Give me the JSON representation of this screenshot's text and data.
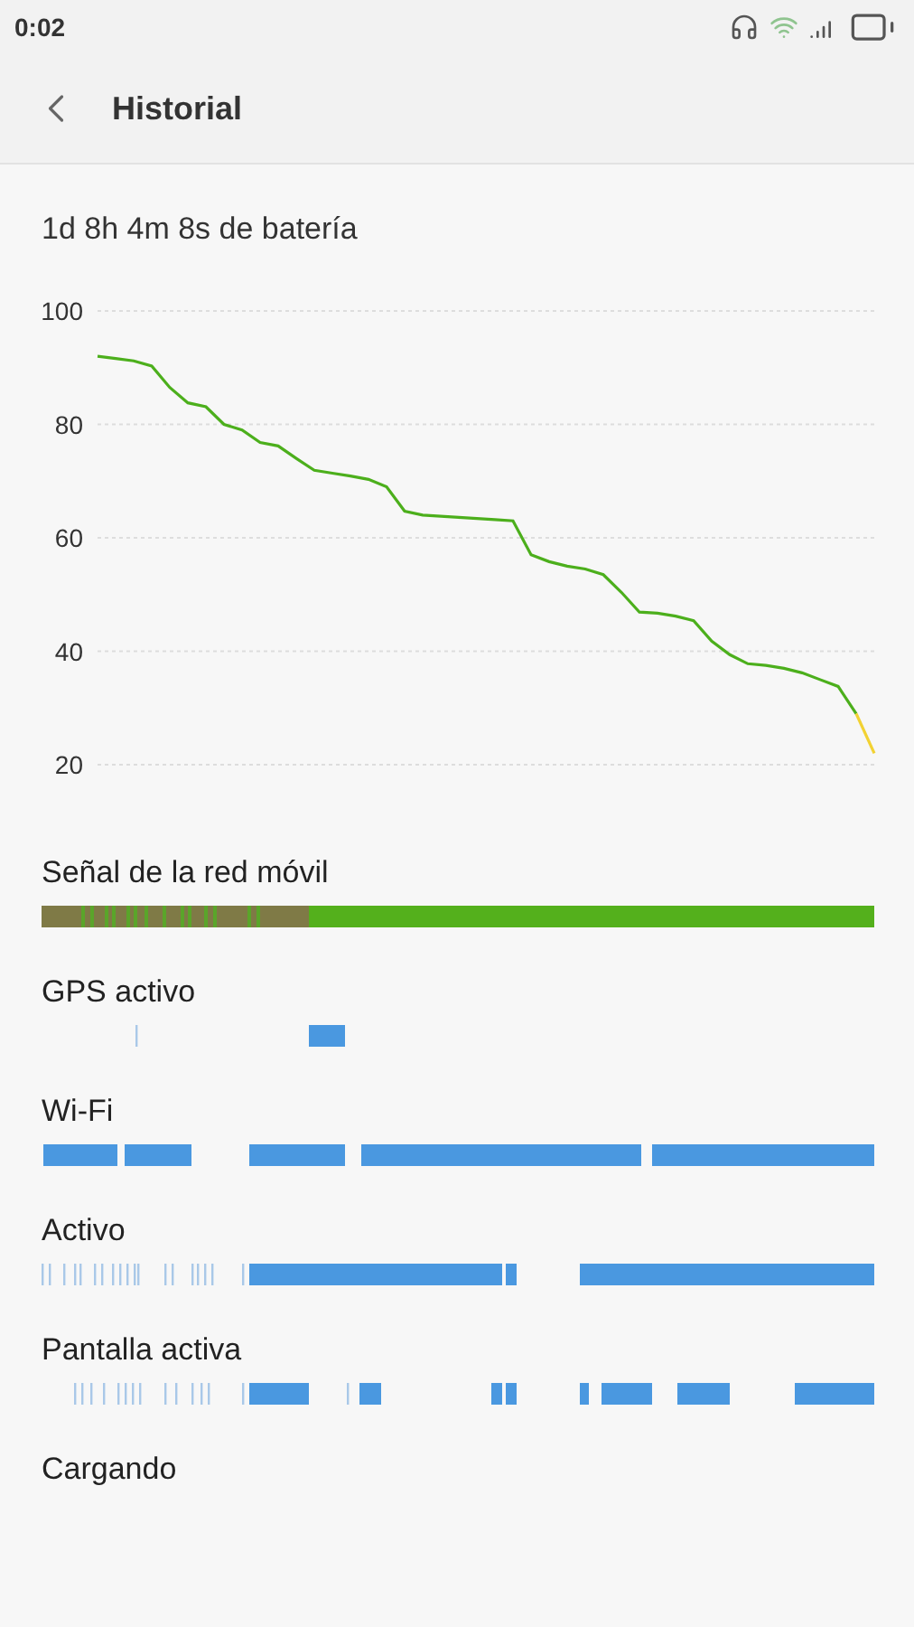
{
  "status_bar": {
    "time": "0:02"
  },
  "header": {
    "title": "Historial"
  },
  "battery_summary": "1d 8h 4m 8s de batería",
  "chart_data": {
    "type": "line",
    "grid": true,
    "ylim": [
      20,
      100
    ],
    "yticks": [
      20,
      40,
      60,
      80,
      100
    ],
    "categories": [
      null,
      null,
      null,
      null,
      null,
      null,
      null,
      null,
      null,
      null,
      null,
      null,
      null,
      null,
      null,
      null,
      null,
      null,
      null,
      null,
      null,
      null,
      null,
      null,
      null,
      null,
      null,
      null,
      null,
      null,
      null,
      null,
      null,
      null,
      null,
      null,
      null,
      null,
      null,
      null,
      null,
      null,
      null,
      null
    ],
    "series": [
      {
        "color": "#4caf1c",
        "values": [
          92,
          91.6,
          91.2,
          90.3,
          86.5,
          83.8,
          83.1,
          80,
          79,
          76.8,
          76.2,
          74,
          71.9,
          71.4,
          70.9,
          70.3,
          69,
          64.7,
          64,
          63.8,
          63.6,
          63.4,
          63.2,
          63,
          57,
          55.8,
          55,
          54.5,
          53.5,
          50.4,
          46.9,
          46.7,
          46.2,
          45.4,
          41.8,
          39.4,
          37.8,
          37.5,
          37,
          36.2,
          35,
          33.8,
          29,
          null
        ]
      },
      {
        "color": "#f2d233",
        "values": [
          null,
          null,
          null,
          null,
          null,
          null,
          null,
          null,
          null,
          null,
          null,
          null,
          null,
          null,
          null,
          null,
          null,
          null,
          null,
          null,
          null,
          null,
          null,
          null,
          null,
          null,
          null,
          null,
          null,
          null,
          null,
          null,
          null,
          null,
          null,
          null,
          null,
          null,
          null,
          null,
          null,
          null,
          29,
          22
        ]
      }
    ]
  },
  "sections": [
    {
      "label": "Señal de la red móvil",
      "kind": "signal"
    },
    {
      "label": "GPS activo",
      "kind": "timeline"
    },
    {
      "label": "Wi-Fi",
      "kind": "timeline"
    },
    {
      "label": "Activo",
      "kind": "timeline"
    },
    {
      "label": "Pantalla activa",
      "kind": "timeline"
    },
    {
      "label": "Cargando",
      "kind": "timeline"
    }
  ]
}
